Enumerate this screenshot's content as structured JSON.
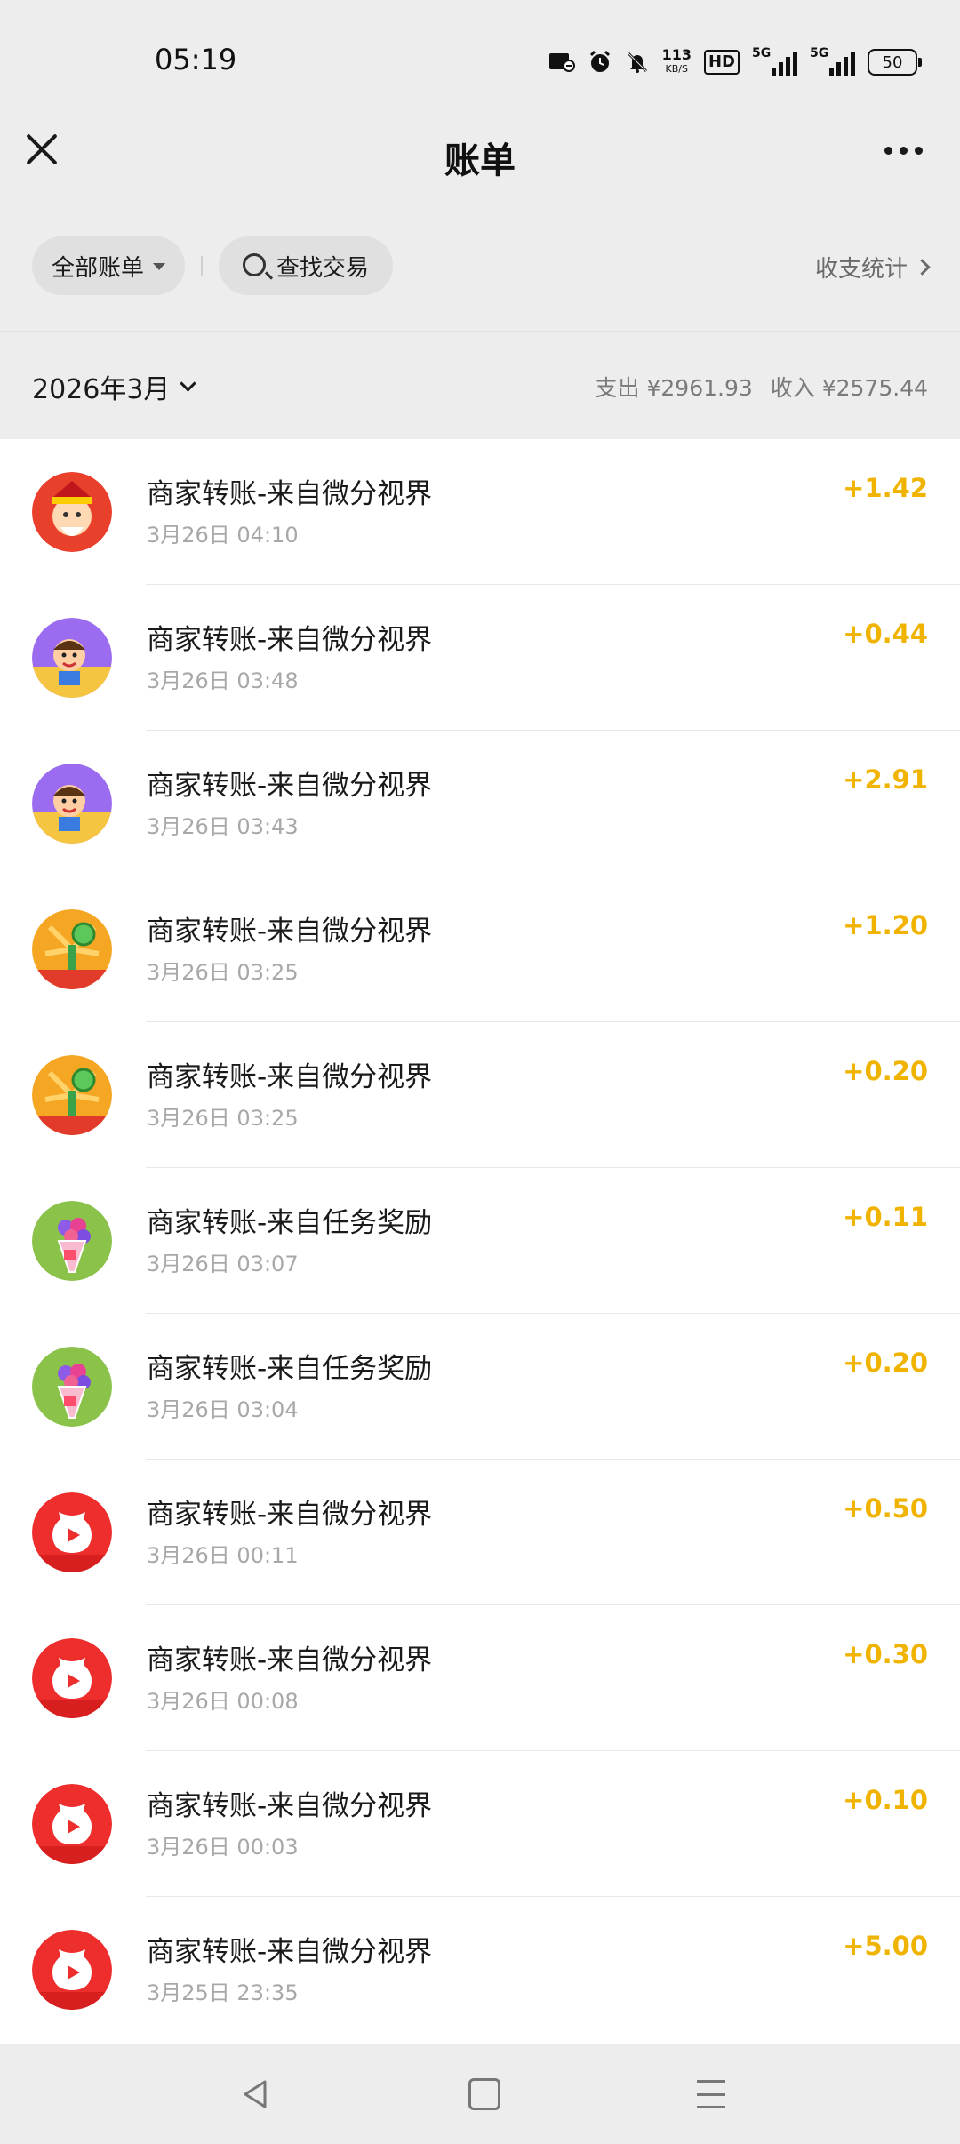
{
  "status": {
    "time": "05:19",
    "net_speed_value": "113",
    "net_speed_unit": "KB/S",
    "hd": "HD",
    "sim1": "5G",
    "sim2": "5G",
    "battery": "50",
    "icons": [
      "card-icon",
      "alarm-icon",
      "mute-icon"
    ]
  },
  "header": {
    "title": "账单"
  },
  "filters": {
    "all_bills": "全部账单",
    "search": "查找交易",
    "stats": "收支统计"
  },
  "month": {
    "label": "2026年3月",
    "expense": "支出 ¥2961.93",
    "income": "收入 ¥2575.44"
  },
  "transactions": [
    {
      "title": "商家转账-来自微分视界",
      "time": "3月26日 04:10",
      "amount": "+1.42",
      "avatar": "god-of-wealth-avatar",
      "avatar_bg": "#e8402a"
    },
    {
      "title": "商家转账-来自微分视界",
      "time": "3月26日 03:48",
      "amount": "+0.44",
      "avatar": "cartoon-boy-avatar",
      "avatar_bg": "#9b6cf0"
    },
    {
      "title": "商家转账-来自微分视界",
      "time": "3月26日 03:43",
      "amount": "+2.91",
      "avatar": "cartoon-boy-avatar",
      "avatar_bg": "#9b6cf0"
    },
    {
      "title": "商家转账-来自微分视界",
      "time": "3月26日 03:25",
      "amount": "+1.20",
      "avatar": "money-tree-avatar",
      "avatar_bg": "#f5a623"
    },
    {
      "title": "商家转账-来自微分视界",
      "time": "3月26日 03:25",
      "amount": "+0.20",
      "avatar": "money-tree-avatar",
      "avatar_bg": "#f5a623"
    },
    {
      "title": "商家转账-来自任务奖励",
      "time": "3月26日 03:07",
      "amount": "+0.11",
      "avatar": "flower-bouquet-avatar",
      "avatar_bg": "#8bc34a"
    },
    {
      "title": "商家转账-来自任务奖励",
      "time": "3月26日 03:04",
      "amount": "+0.20",
      "avatar": "flower-bouquet-avatar",
      "avatar_bg": "#8bc34a"
    },
    {
      "title": "商家转账-来自微分视界",
      "time": "3月26日 00:11",
      "amount": "+0.50",
      "avatar": "lucky-bag-play-avatar",
      "avatar_bg": "#ee2d2d"
    },
    {
      "title": "商家转账-来自微分视界",
      "time": "3月26日 00:08",
      "amount": "+0.30",
      "avatar": "lucky-bag-play-avatar",
      "avatar_bg": "#ee2d2d"
    },
    {
      "title": "商家转账-来自微分视界",
      "time": "3月26日 00:03",
      "amount": "+0.10",
      "avatar": "lucky-bag-play-avatar",
      "avatar_bg": "#ee2d2d"
    },
    {
      "title": "商家转账-来自微分视界",
      "time": "3月25日 23:35",
      "amount": "+5.00",
      "avatar": "lucky-bag-play-avatar",
      "avatar_bg": "#ee2d2d"
    }
  ],
  "colors": {
    "amount": "#f0b400",
    "background": "#ededed",
    "list_background": "#ffffff"
  }
}
